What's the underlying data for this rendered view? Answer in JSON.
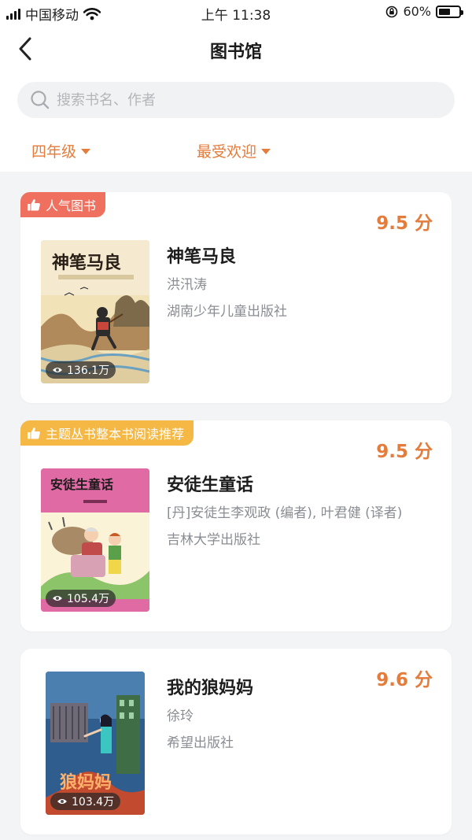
{
  "status_bar": {
    "carrier": "中国移动",
    "time": "上午 11:38",
    "battery": "60%",
    "battery_level": 0.6
  },
  "nav": {
    "title": "图书馆",
    "back_icon": "chevron-left-icon"
  },
  "search": {
    "placeholder": "搜索书名、作者",
    "value": ""
  },
  "filters": {
    "grade": "四年级",
    "sort": "最受欢迎"
  },
  "colors": {
    "accent": "#e47c3b",
    "badge_red": "#f07060",
    "badge_orange": "#f5b845"
  },
  "books": [
    {
      "badge": "人气图书",
      "score": "9.5 分",
      "title": "神笔马良",
      "author": "洪汛涛",
      "publisher": "湖南少年儿童出版社",
      "views": "136.1万",
      "cover_title": "神笔马良"
    },
    {
      "badge": "主题丛书整本书阅读推荐",
      "score": "9.5 分",
      "title": "安徒生童话",
      "author": "[丹]安徒生李观政 (编者), 叶君健 (译者)",
      "publisher": "吉林大学出版社",
      "views": "105.4万",
      "cover_title": "安徒生童话"
    },
    {
      "score": "9.6 分",
      "title": "我的狼妈妈",
      "author": "徐玲",
      "publisher": "希望出版社",
      "views": "103.4万",
      "cover_title": "狼妈妈"
    }
  ]
}
